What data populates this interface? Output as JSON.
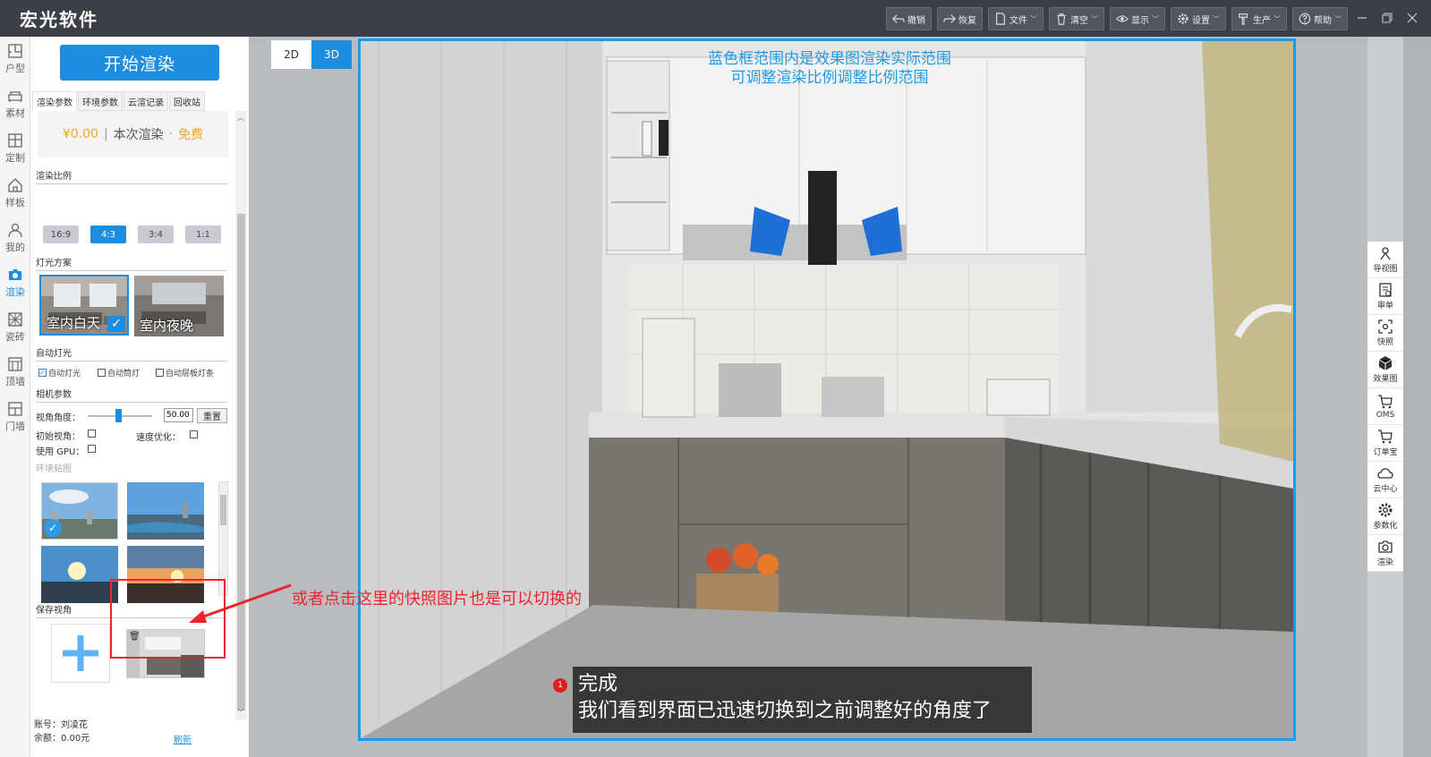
{
  "app": {
    "title": "宏光软件"
  },
  "toolbar": [
    {
      "label": "撤销",
      "icon": "undo-icon"
    },
    {
      "label": "恢复",
      "icon": "redo-icon"
    },
    {
      "label": "文件",
      "icon": "file-icon"
    },
    {
      "label": "清空",
      "icon": "trash-icon"
    },
    {
      "label": "显示",
      "icon": "eye-icon"
    },
    {
      "label": "设置",
      "icon": "gear-icon"
    },
    {
      "label": "生产",
      "icon": "hammer-icon"
    },
    {
      "label": "帮助",
      "icon": "help-icon"
    }
  ],
  "leftnav": [
    {
      "label": "户型",
      "icon": "floorplan-icon"
    },
    {
      "label": "素材",
      "icon": "sofa-icon"
    },
    {
      "label": "定制",
      "icon": "cabinet-icon"
    },
    {
      "label": "样板",
      "icon": "house-icon"
    },
    {
      "label": "我的",
      "icon": "user-icon"
    },
    {
      "label": "渲染",
      "icon": "camera-icon",
      "active": true
    },
    {
      "label": "瓷砖",
      "icon": "tile-icon"
    },
    {
      "label": "顶墙",
      "icon": "ceiling-icon"
    },
    {
      "label": "门墙",
      "icon": "door-icon"
    }
  ],
  "panel": {
    "start_button": "开始渲染",
    "tabs": [
      "渲染参数",
      "环境参数",
      "云渲记录",
      "回收站"
    ],
    "price": "¥0.00",
    "price_sep": "|",
    "price_label": "本次渲染",
    "price_dot": "·",
    "price_free": "免费",
    "ratio_title": "渲染比例",
    "ratios": [
      "16:9",
      "4:3",
      "3:4",
      "1:1"
    ],
    "ratio_active": "4:3",
    "light_title": "灯光方案",
    "lights": [
      "室内白天",
      "室内夜晚"
    ],
    "auto_title": "自动灯光",
    "auto_opts": [
      "自动灯光",
      "自动筒灯",
      "自动层板灯条"
    ],
    "camera_title": "相机参数",
    "fov_label": "视角角度：",
    "fov_value": "50.00",
    "reset_label": "重置",
    "init_view_label": "初始视角：",
    "speed_label": "速度优化：",
    "gpu_label": "使用 GPU：",
    "env_title": "环境贴图",
    "save_title": "保存视角",
    "account": "账号：刘凌花",
    "balance": "余额：0.00元",
    "refresh": "刷新"
  },
  "viewport": {
    "btn_2d": "2D",
    "btn_3d": "3D",
    "note_line1": "蓝色框范围内是效果图渲染实际范围",
    "note_line2": "可调整渲染比例调整比例范围",
    "callout": "或者点击这里的快照图片也是可以切换的",
    "subtitle_num": "1",
    "subtitle_line1": "完成",
    "subtitle_line2": "我们看到界面已迅速切换到之前调整好的角度了"
  },
  "rightbar": [
    {
      "label": "导视图",
      "icon": "compass-icon"
    },
    {
      "label": "审单",
      "icon": "document-icon"
    },
    {
      "label": "快照",
      "icon": "snapshot-icon"
    },
    {
      "label": "效果图",
      "icon": "cube-icon"
    },
    {
      "label": "OMS",
      "icon": "cart-icon"
    },
    {
      "label": "订单宝",
      "icon": "cart-icon"
    },
    {
      "label": "云中心",
      "icon": "cloud-icon"
    },
    {
      "label": "参数化",
      "icon": "gear-icon"
    },
    {
      "label": "渲染",
      "icon": "camera-icon"
    }
  ],
  "colors": {
    "accent": "#1e8de0",
    "frame": "#1e9be8",
    "annotation": "#f2222a",
    "price": "#f5a623"
  }
}
